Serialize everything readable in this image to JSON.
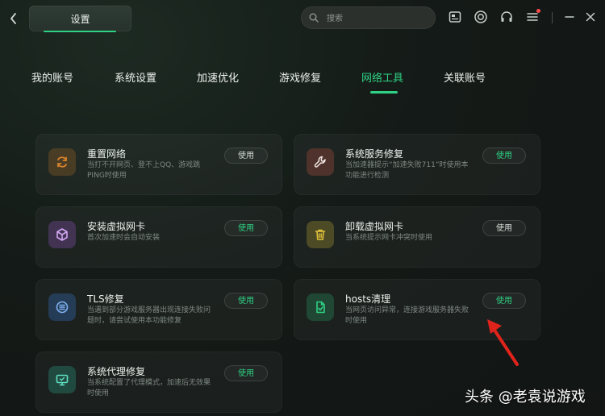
{
  "window": {
    "title": "设置"
  },
  "search": {
    "placeholder": "搜索"
  },
  "tabs": [
    {
      "label": "我的账号"
    },
    {
      "label": "系统设置"
    },
    {
      "label": "加速优化"
    },
    {
      "label": "游戏修复"
    },
    {
      "label": "网络工具",
      "active": true
    },
    {
      "label": "关联账号"
    }
  ],
  "tools": [
    {
      "name": "重置网络",
      "desc": "当打不开网页、登不上QQ、游戏跳PING时使用",
      "button": "使用",
      "icon": "reset-icon",
      "color": "#d9822b"
    },
    {
      "name": "系统服务修复",
      "desc": "当加速器提示“加速失败711”时使用本功能进行检测",
      "button": "使用",
      "icon": "wrench-icon",
      "color": "#e35d4a"
    },
    {
      "name": "安装虚拟网卡",
      "desc": "首次加速时会自动安装",
      "button": "使用",
      "icon": "cube-icon",
      "color": "#a55ad9"
    },
    {
      "name": "卸载虚拟网卡",
      "desc": "当系统提示网卡冲突时使用",
      "button": "使用",
      "icon": "trash-icon",
      "color": "#e0c23a"
    },
    {
      "name": "TLS修复",
      "desc": "当遇到部分游戏服务器出现连接失败问题时，请尝试使用本功能修复",
      "button": "使用",
      "icon": "tls-icon",
      "color": "#3e86e6"
    },
    {
      "name": "hosts清理",
      "desc": "当网页访问异常，连接游戏服务器失败时使用",
      "button": "使用",
      "icon": "file-clean-icon",
      "color": "#2fd184"
    },
    {
      "name": "系统代理修复",
      "desc": "当系统配置了代理模式，加速后无效果时使用",
      "button": "使用",
      "icon": "monitor-icon",
      "color": "#2ec4a4"
    }
  ],
  "watermark": {
    "text": "头条 @老袁说游戏"
  },
  "colors": {
    "accent": "#2fd184",
    "annotation": "#e0241c"
  }
}
